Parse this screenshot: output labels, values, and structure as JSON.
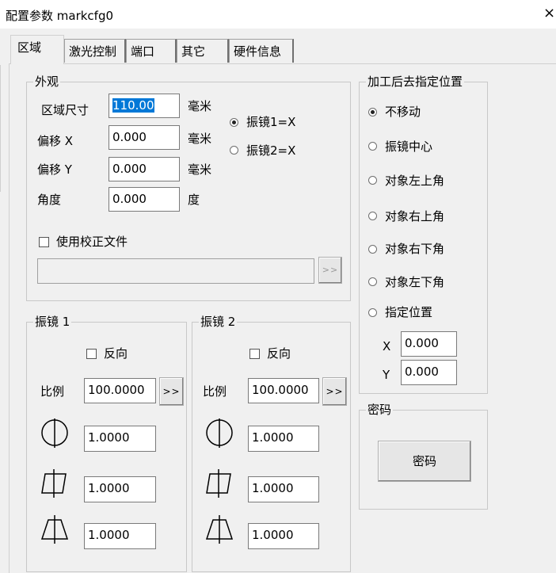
{
  "window": {
    "title": "配置参数 markcfg0",
    "close_glyph": "×"
  },
  "tabs": [
    {
      "label": "区域",
      "active": true
    },
    {
      "label": "激光控制"
    },
    {
      "label": "端口"
    },
    {
      "label": "其它"
    },
    {
      "label": "硬件信息"
    }
  ],
  "appearance": {
    "legend": "外观",
    "area_size_label": "区域尺寸",
    "area_size_value": "110.00",
    "area_size_unit": "毫米",
    "offset_x_label": "偏移 X",
    "offset_x_value": "0.000",
    "offset_x_unit": "毫米",
    "offset_y_label": "偏移 Y",
    "offset_y_value": "0.000",
    "offset_y_unit": "毫米",
    "angle_label": "角度",
    "angle_value": "0.000",
    "angle_unit": "度",
    "galvo1_radio": "振镜1=X",
    "galvo2_radio": "振镜2=X",
    "use_correction_label": "使用校正文件",
    "correction_path": "",
    "browse_label": ">>"
  },
  "galvo1": {
    "legend": "振镜 1",
    "reverse_label": "反向",
    "scale_label": "比例",
    "scale_value": "100.0000",
    "scale_btn": ">>",
    "param1": "1.0000",
    "param2": "1.0000",
    "param3": "1.0000"
  },
  "galvo2": {
    "legend": "振镜 2",
    "reverse_label": "反向",
    "scale_label": "比例",
    "scale_value": "100.0000",
    "scale_btn": ">>",
    "param1": "1.0000",
    "param2": "1.0000",
    "param3": "1.0000"
  },
  "after_process": {
    "legend": "加工后去指定位置",
    "options": [
      "不移动",
      "振镜中心",
      "对象左上角",
      "对象右上角",
      "对象右下角",
      "对象左下角",
      "指定位置"
    ],
    "selected": "不移动",
    "x_label": "X",
    "x_value": "0.000",
    "y_label": "Y",
    "y_value": "0.000"
  },
  "password": {
    "legend": "密码",
    "button_label": "密码"
  }
}
